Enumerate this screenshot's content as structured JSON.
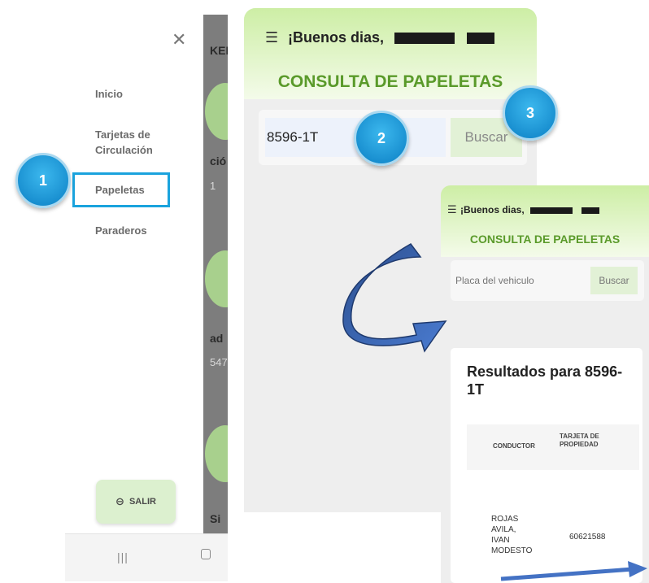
{
  "menu_panel": {
    "close_icon": "close-icon",
    "items": [
      {
        "label": "Inicio"
      },
      {
        "label": "Tarjetas de Circulación"
      },
      {
        "label": "Papeletas"
      },
      {
        "label": "Paraderos"
      }
    ],
    "logout_label": "SALIR",
    "logout_icon": "logout-icon",
    "background_fragments": [
      "KEI",
      "ció",
      "1",
      "ad",
      "547",
      "Si"
    ],
    "navbar_icons": [
      "recent-apps-icon",
      "home-icon"
    ]
  },
  "consulta_panel": {
    "greeting": "¡Buenos dias,",
    "title": "CONSULTA DE PAPELETAS",
    "plate_value": "8596-1T",
    "search_label": "Buscar"
  },
  "results_panel": {
    "greeting": "¡Buenos dias,",
    "title": "CONSULTA DE PAPELETAS",
    "plate_placeholder": "Placa del vehiculo",
    "search_label": "Buscar",
    "results_title": "Resultados para 8596-1T",
    "table": {
      "headers": [
        "CONDUCTOR",
        "TARJETA DE PROPIEDAD"
      ],
      "rows": [
        [
          "ROJAS AVILA, IVAN MODESTO",
          "60621588"
        ]
      ]
    }
  },
  "steps": [
    "1",
    "2",
    "3"
  ],
  "colors": {
    "header_green": "#cdeea5",
    "title_green": "#5a9a2a",
    "button_green": "#e2f1d6",
    "step_blue": "#1aa3dd",
    "arrow_blue": "#4472c4"
  }
}
